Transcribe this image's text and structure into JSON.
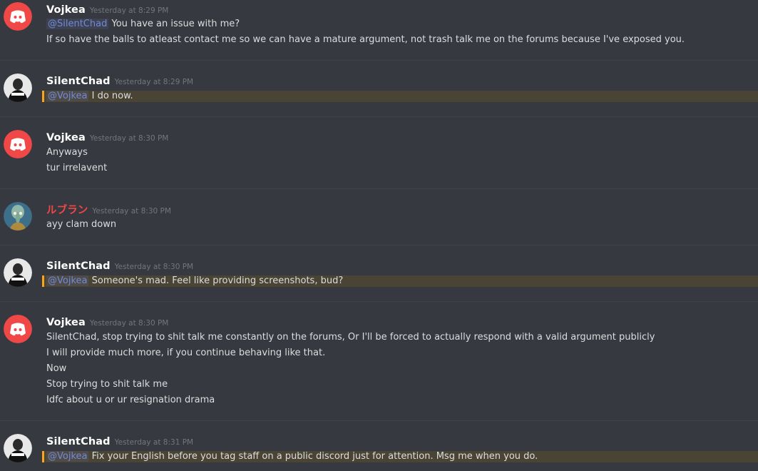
{
  "messages": [
    {
      "author": "Vojkea",
      "timestamp": "Yesterday at 8:29 PM",
      "lines": [
        {
          "mention": "@SilentChad",
          "text": " You have an issue with me?"
        },
        {
          "text": "If so have the balls to atleast contact me so we can have a mature argument, not trash talk me on the forums because I've exposed you."
        }
      ]
    },
    {
      "author": "SilentChad",
      "timestamp": "Yesterday at 8:29 PM",
      "lines": [
        {
          "mention": "@Vojkea",
          "text": " I do now.",
          "highlighted": true
        }
      ]
    },
    {
      "author": "Vojkea",
      "timestamp": "Yesterday at 8:30 PM",
      "lines": [
        {
          "text": "Anyways"
        },
        {
          "text": "tur irrelavent"
        }
      ]
    },
    {
      "author": "ルブラン",
      "timestamp": "Yesterday at 8:30 PM",
      "lines": [
        {
          "text": "ayy clam down"
        }
      ]
    },
    {
      "author": "SilentChad",
      "timestamp": "Yesterday at 8:30 PM",
      "lines": [
        {
          "mention": "@Vojkea",
          "text": "  Someone's mad. Feel like providing screenshots, bud?",
          "highlighted": true
        }
      ]
    },
    {
      "author": "Vojkea",
      "timestamp": "Yesterday at 8:30 PM",
      "lines": [
        {
          "text": "SilentChad, stop trying to shit talk me constantly on the forums, Or I'll be forced to actually respond with a valid argument publicly"
        },
        {
          "text": "I will provide much more, if you continue behaving like that."
        },
        {
          "text": "Now"
        },
        {
          "text": "Stop trying to shit talk me"
        },
        {
          "text": "Idfc about u or ur resignation drama"
        }
      ]
    },
    {
      "author": "SilentChad",
      "timestamp": "Yesterday at 8:31 PM",
      "lines": [
        {
          "mention": "@Vojkea",
          "text": "  Fix your English before you tag staff on a public discord just for attention. Msg me when you do.",
          "highlighted": true
        }
      ]
    }
  ],
  "colors": {
    "background": "#36393f",
    "username": "#ffffff",
    "username_red": "#f04747",
    "mention": "#7289da",
    "mention_highlight": "#4a4434",
    "mention_bar": "#faa61a",
    "discord_avatar": "#f04747"
  },
  "icons": {
    "vojkea_avatar": "discord-logo-icon",
    "silentchad_avatar": "user-photo-avatar",
    "luburan_avatar": "squidward-avatar"
  }
}
